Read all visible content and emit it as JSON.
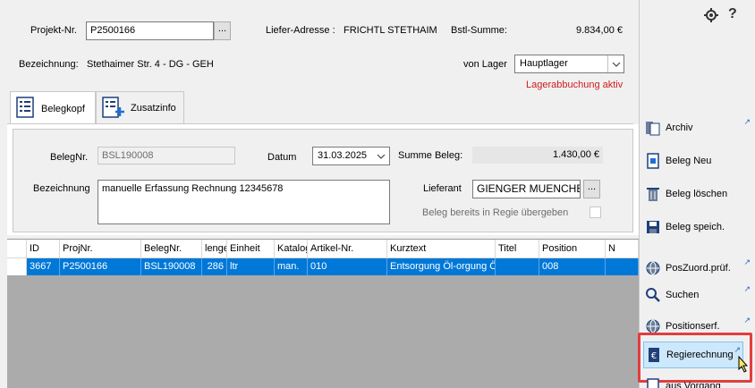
{
  "header": {
    "projekt_label": "Projekt-Nr.",
    "projekt_value": "P2500166",
    "lookup_label": "...",
    "liefer_label": "Liefer-Adresse :",
    "liefer_value": "FRICHTL STETHAIM",
    "bstl_label": "Bstl-Summe:",
    "bstl_value": "9.834,00 €",
    "bez_label": "Bezeichnung:",
    "bez_value": "Stethaimer Str. 4 - DG - GEH",
    "lager_label": "von Lager",
    "lager_value": "Hauptlager",
    "lager_status": "Lagerabbuchung aktiv"
  },
  "tabs": [
    {
      "label": "Belegkopf",
      "active": true
    },
    {
      "label": "Zusatzinfo",
      "active": false
    }
  ],
  "form": {
    "belegnr_label": "BelegNr.",
    "belegnr_value": "BSL190008",
    "datum_label": "Datum",
    "datum_value": "31.03.2025",
    "summe_label": "Summe Beleg:",
    "summe_value": "1.430,00 €",
    "bez_label": "Bezeichnung",
    "bez_value": "manuelle Erfassung Rechnung 12345678",
    "lieferant_label": "Lieferant",
    "lieferant_value": "GIENGER MUENCHEN",
    "regie_label": "Beleg bereits in Regie übergeben"
  },
  "grid": {
    "columns": [
      "ID",
      "ProjNr.",
      "BelegNr.",
      "lenge",
      "Einheit",
      "Katalog",
      "Artikel-Nr.",
      "Kurztext",
      "Titel",
      "Position",
      "N"
    ],
    "row": [
      "3667",
      "P2500166",
      "BSL190008",
      "286",
      "ltr",
      "man.",
      "010",
      "Entsorgung Öl-orgung Öl",
      "",
      "008",
      ""
    ]
  },
  "toolbar": {
    "help": "?"
  },
  "sidebar": [
    {
      "label": "Archiv",
      "icon": "archive-icon"
    },
    {
      "label": "Beleg Neu",
      "icon": "new-document-icon"
    },
    {
      "label": "Beleg löschen",
      "icon": "trash-icon"
    },
    {
      "label": "Beleg speich.",
      "icon": "save-icon"
    },
    {
      "label": "PosZuord.prüf.",
      "icon": "globe-icon"
    },
    {
      "label": "Suchen",
      "icon": "search-icon"
    },
    {
      "label": "Positionserf.",
      "icon": "globe-icon"
    },
    {
      "label": "Regierechnung",
      "icon": "euro-document-icon"
    },
    {
      "label": "aus Vorgang",
      "icon": "document-icon"
    }
  ],
  "colors": {
    "accent": "#0078d7",
    "status_red": "#d11a1a",
    "highlight_border": "#e33d3d"
  }
}
